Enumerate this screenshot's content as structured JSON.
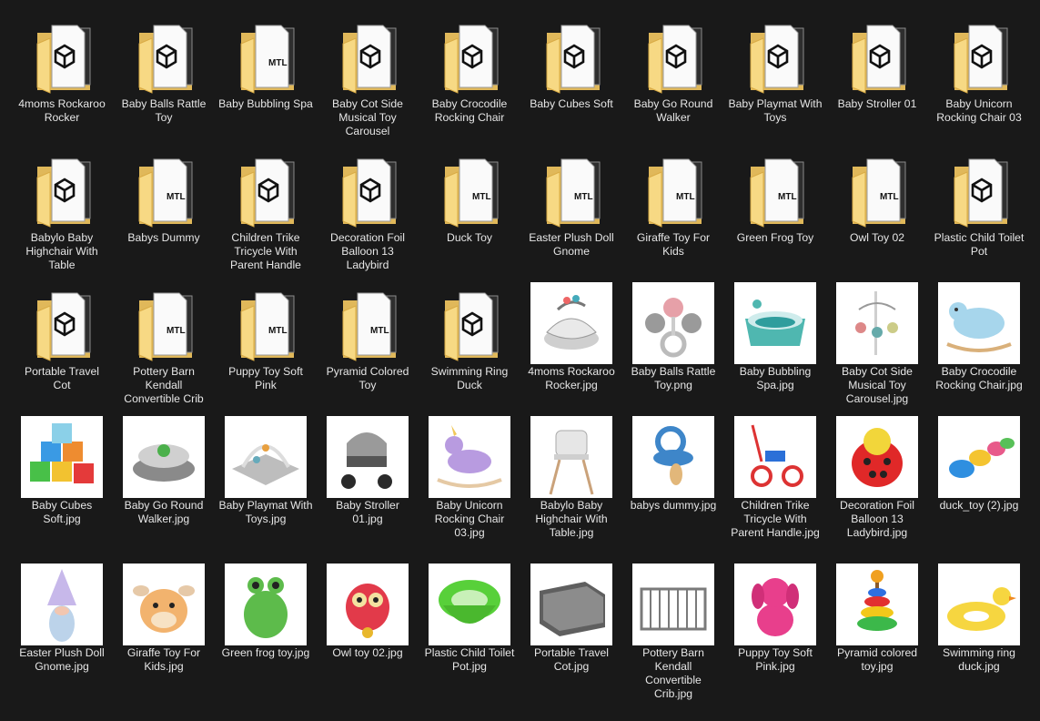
{
  "folders": [
    {
      "name": "4moms Rockaroo Rocker",
      "icon": "folder-icon",
      "preview": "doc-icon"
    },
    {
      "name": "Baby Balls Rattle Toy",
      "icon": "folder-icon",
      "preview": "doc-icon"
    },
    {
      "name": "Baby Bubbling Spa",
      "icon": "folder-icon",
      "preview": "mtl-file-icon"
    },
    {
      "name": "Baby Cot Side Musical Toy Carousel",
      "icon": "folder-icon",
      "preview": "doc-icon"
    },
    {
      "name": "Baby Crocodile Rocking Chair",
      "icon": "folder-icon",
      "preview": "doc-icon"
    },
    {
      "name": "Baby Cubes Soft",
      "icon": "folder-icon",
      "preview": "doc-icon"
    },
    {
      "name": "Baby Go Round Walker",
      "icon": "folder-icon",
      "preview": "doc-icon"
    },
    {
      "name": "Baby Playmat With Toys",
      "icon": "folder-icon",
      "preview": "doc-icon"
    },
    {
      "name": "Baby Stroller 01",
      "icon": "folder-icon",
      "preview": "doc-icon"
    },
    {
      "name": "Baby Unicorn Rocking Chair 03",
      "icon": "folder-icon",
      "preview": "doc-icon"
    },
    {
      "name": "Babylo Baby Highchair With Table",
      "icon": "folder-icon",
      "preview": "doc-icon"
    },
    {
      "name": "Babys Dummy",
      "icon": "folder-icon",
      "preview": "mtl-file-icon"
    },
    {
      "name": "Children Trike Tricycle With Parent Handle",
      "icon": "folder-icon",
      "preview": "doc-icon"
    },
    {
      "name": "Decoration Foil Balloon 13 Ladybird",
      "icon": "folder-icon",
      "preview": "doc-icon"
    },
    {
      "name": "Duck Toy",
      "icon": "folder-icon",
      "preview": "mtl-file-icon"
    },
    {
      "name": "Easter Plush Doll Gnome",
      "icon": "folder-icon",
      "preview": "mtl-file-icon"
    },
    {
      "name": "Giraffe Toy For Kids",
      "icon": "folder-icon",
      "preview": "mtl-file-icon"
    },
    {
      "name": "Green Frog Toy",
      "icon": "folder-icon",
      "preview": "mtl-file-icon"
    },
    {
      "name": "Owl Toy 02",
      "icon": "folder-icon",
      "preview": "mtl-file-icon"
    },
    {
      "name": "Plastic Child Toilet Pot",
      "icon": "folder-icon",
      "preview": "doc-icon"
    },
    {
      "name": "Portable Travel Cot",
      "icon": "folder-icon",
      "preview": "doc-icon"
    },
    {
      "name": "Pottery Barn Kendall Convertible Crib",
      "icon": "folder-icon",
      "preview": "mtl-file-icon"
    },
    {
      "name": "Puppy Toy Soft Pink",
      "icon": "folder-icon",
      "preview": "mtl-file-icon"
    },
    {
      "name": "Pyramid Colored Toy",
      "icon": "folder-icon",
      "preview": "mtl-file-icon"
    },
    {
      "name": "Swimming Ring Duck",
      "icon": "folder-icon",
      "preview": "doc-icon"
    }
  ],
  "images": [
    {
      "name": "4moms Rockaroo Rocker.jpg",
      "icon": "baby-rocker-thumbnail"
    },
    {
      "name": "Baby Balls Rattle Toy.png",
      "icon": "rattle-toy-thumbnail"
    },
    {
      "name": "Baby Bubbling Spa.jpg",
      "icon": "baby-bath-thumbnail"
    },
    {
      "name": "Baby Cot Side Musical Toy Carousel.jpg",
      "icon": "crib-mobile-thumbnail"
    },
    {
      "name": "Baby Crocodile Rocking Chair.jpg",
      "icon": "rocking-animal-thumbnail"
    },
    {
      "name": "Baby Cubes Soft.jpg",
      "icon": "soft-cubes-thumbnail"
    },
    {
      "name": "Baby Go Round Walker.jpg",
      "icon": "baby-walker-thumbnail"
    },
    {
      "name": "Baby Playmat With Toys.jpg",
      "icon": "playmat-thumbnail"
    },
    {
      "name": "Baby Stroller 01.jpg",
      "icon": "stroller-thumbnail"
    },
    {
      "name": "Baby Unicorn Rocking Chair 03.jpg",
      "icon": "unicorn-rocker-thumbnail"
    },
    {
      "name": "Babylo Baby Highchair With Table.jpg",
      "icon": "highchair-thumbnail"
    },
    {
      "name": "babys dummy.jpg",
      "icon": "pacifier-thumbnail"
    },
    {
      "name": "Children Trike Tricycle With Parent Handle.jpg",
      "icon": "tricycle-thumbnail"
    },
    {
      "name": "Decoration Foil Balloon 13 Ladybird.jpg",
      "icon": "ladybird-balloon-thumbnail"
    },
    {
      "name": "duck_toy (2).jpg",
      "icon": "duck-toy-thumbnail"
    },
    {
      "name": "Easter Plush Doll Gnome.jpg",
      "icon": "gnome-thumbnail"
    },
    {
      "name": "Giraffe Toy For Kids.jpg",
      "icon": "giraffe-toy-thumbnail"
    },
    {
      "name": "Green frog toy.jpg",
      "icon": "frog-toy-thumbnail"
    },
    {
      "name": "Owl toy 02.jpg",
      "icon": "owl-toy-thumbnail"
    },
    {
      "name": "Plastic Child Toilet Pot.jpg",
      "icon": "potty-thumbnail"
    },
    {
      "name": "Portable Travel Cot.jpg",
      "icon": "travel-cot-thumbnail"
    },
    {
      "name": "Pottery Barn Kendall Convertible Crib.jpg",
      "icon": "crib-thumbnail"
    },
    {
      "name": "Puppy Toy Soft Pink.jpg",
      "icon": "puppy-toy-thumbnail"
    },
    {
      "name": "Pyramid colored toy.jpg",
      "icon": "stacking-pyramid-thumbnail"
    },
    {
      "name": "Swimming ring duck.jpg",
      "icon": "swim-ring-thumbnail"
    }
  ],
  "colors": {
    "background": "#191919",
    "label_text": "#e6e6e6",
    "folder_back": "#e0b85a",
    "folder_front": "#f7d984"
  }
}
